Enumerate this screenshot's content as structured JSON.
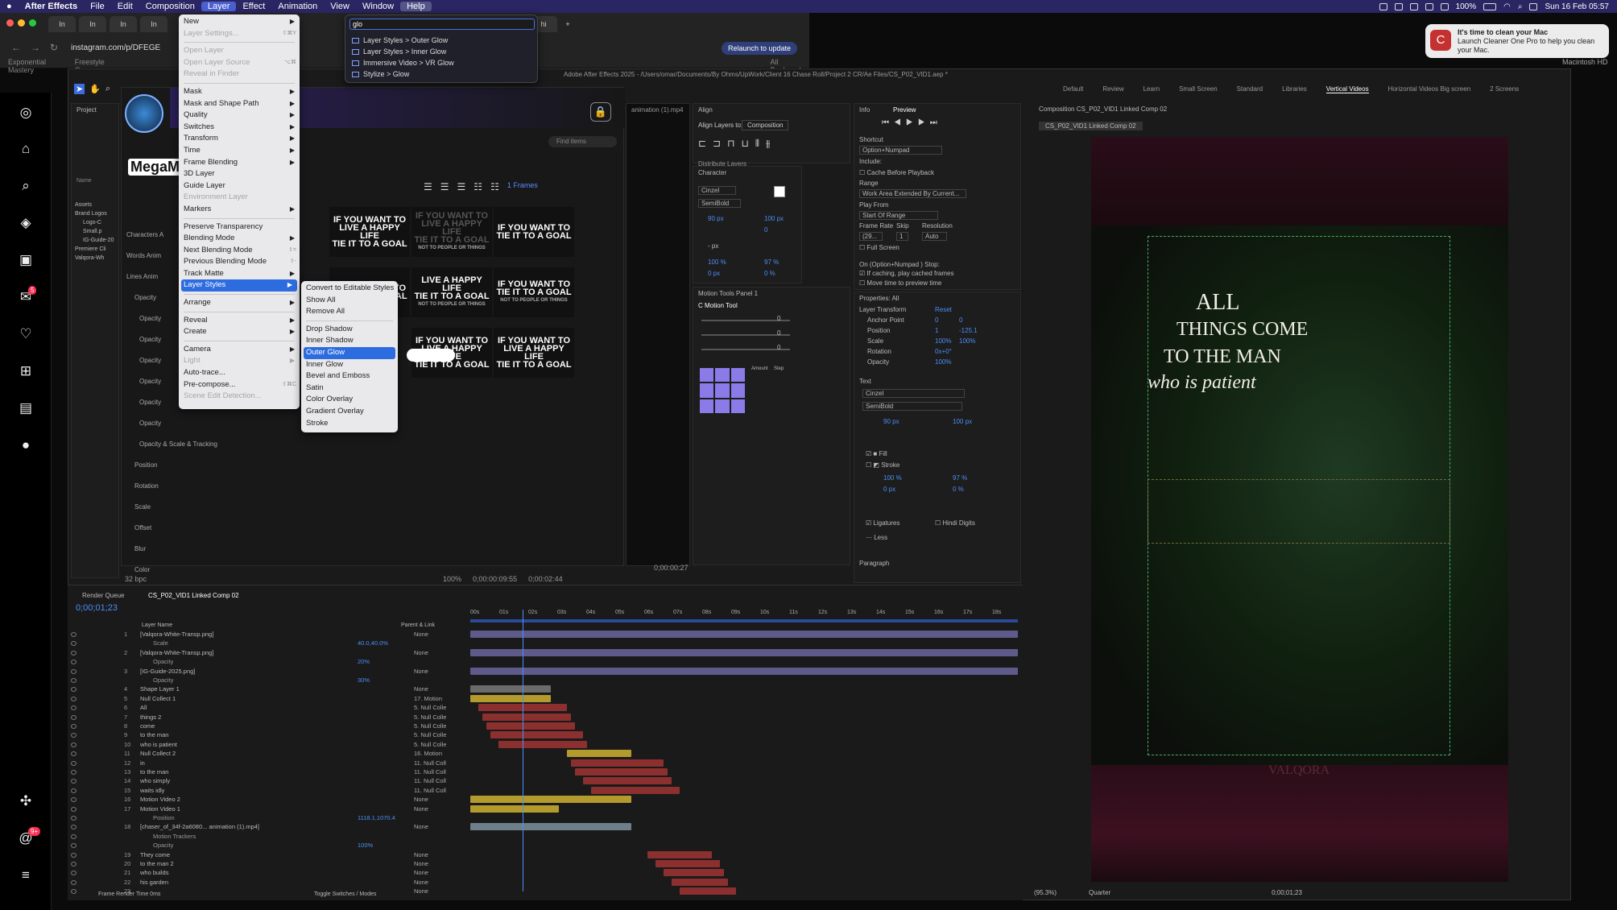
{
  "menubar": {
    "app": "After Effects",
    "items": [
      "File",
      "Edit",
      "Composition",
      "Layer",
      "Effect",
      "Animation",
      "View",
      "Window",
      "Help"
    ],
    "battery": "100%",
    "clock": "Sun 16 Feb 05:57"
  },
  "browser": {
    "url": "instagram.com/p/DFEGE",
    "relaunch": "Relaunch to update",
    "bookmark1": "Exponential Mastery",
    "bookmark2": "Freestyle On...",
    "bookmark3": "All Bookmarks",
    "tabs": [
      "In",
      "In",
      "In",
      "In",
      "In",
      "b",
      "11",
      "C",
      "hi"
    ]
  },
  "ig_sidebar": {
    "notif_badge": "5",
    "msg_badge": "9+"
  },
  "ae": {
    "title": "Adobe After Effects 2025 - /Users/omar/Documents/By Ohms/UpWork/Client 16 Chase Roll/Project 2 CR/Ae Files/CS_P02_VID1.aep *",
    "workspaces": [
      "Default",
      "Review",
      "Learn",
      "Small Screen",
      "Standard",
      "Libraries",
      "Vertical Videos",
      "Horizontal Videos Big screen",
      "2 Screens"
    ],
    "active_ws": "Vertical Videos"
  },
  "layer_menu": {
    "items": [
      {
        "l": "New",
        "arrow": true
      },
      {
        "l": "Layer Settings...",
        "dis": true,
        "sc": "⇧⌘Y"
      },
      {
        "sep": true
      },
      {
        "l": "Open Layer",
        "dis": true
      },
      {
        "l": "Open Layer Source",
        "dis": true,
        "sc": "⌥⌘"
      },
      {
        "l": "Reveal in Finder",
        "dis": true
      },
      {
        "sep": true
      },
      {
        "l": "Mask",
        "arrow": true
      },
      {
        "l": "Mask and Shape Path",
        "arrow": true
      },
      {
        "l": "Quality",
        "arrow": true
      },
      {
        "l": "Switches",
        "arrow": true
      },
      {
        "l": "Transform",
        "arrow": true
      },
      {
        "l": "Time",
        "arrow": true
      },
      {
        "l": "Frame Blending",
        "arrow": true
      },
      {
        "l": "3D Layer"
      },
      {
        "l": "Guide Layer"
      },
      {
        "l": "Environment Layer",
        "dis": true
      },
      {
        "l": "Markers",
        "arrow": true
      },
      {
        "sep": true
      },
      {
        "l": "Preserve Transparency"
      },
      {
        "l": "Blending Mode",
        "arrow": true
      },
      {
        "l": "Next Blending Mode",
        "sc": "⇧="
      },
      {
        "l": "Previous Blending Mode",
        "sc": "⇧-"
      },
      {
        "l": "Track Matte",
        "arrow": true
      },
      {
        "l": "Layer Styles",
        "arrow": true,
        "sel": true
      },
      {
        "sep": true
      },
      {
        "l": "Arrange",
        "arrow": true
      },
      {
        "sep": true
      },
      {
        "l": "Reveal",
        "arrow": true
      },
      {
        "l": "Create",
        "arrow": true
      },
      {
        "sep": true
      },
      {
        "l": "Camera",
        "arrow": true
      },
      {
        "l": "Light",
        "dis": true,
        "arrow": true
      },
      {
        "l": "Auto-trace..."
      },
      {
        "l": "Pre-compose...",
        "sc": "⇧⌘C"
      },
      {
        "l": "Scene Edit Detection...",
        "dis": true
      }
    ]
  },
  "layer_styles_sub": {
    "items": [
      {
        "l": "Convert to Editable Styles"
      },
      {
        "l": "Show All"
      },
      {
        "l": "Remove All"
      },
      {
        "sep": true
      },
      {
        "l": "Drop Shadow"
      },
      {
        "l": "Inner Shadow"
      },
      {
        "l": "Outer Glow",
        "sel": true
      },
      {
        "l": "Inner Glow"
      },
      {
        "l": "Bevel and Emboss"
      },
      {
        "l": "Satin"
      },
      {
        "l": "Color Overlay"
      },
      {
        "l": "Gradient Overlay"
      },
      {
        "l": "Stroke"
      }
    ]
  },
  "search": {
    "query": "glo",
    "results": [
      "Layer Styles > Outer Glow",
      "Layer Styles > Inner Glow",
      "Immersive Video > VR Glow",
      "Stylize > Glow"
    ]
  },
  "notification": {
    "title": "It's time to clean your Mac",
    "body": "Launch Cleaner One Pro to help you clean your Mac.",
    "user": "Macintosh HD"
  },
  "project": {
    "title": "Project",
    "items": [
      "Assets",
      "Brand Logos",
      "Logo-C",
      "Small.p",
      "IG-Guide-20",
      "Premiere Cli",
      "Valqora-Wh"
    ],
    "col": "Name"
  },
  "motionbro": {
    "brand": "MegaM",
    "find": "Find items",
    "frames": "1 Frames",
    "cats": [
      "Characters A",
      "Words Anim",
      "Lines Anim",
      "Opacity",
      "Opacity",
      "Opacity",
      "Opacity",
      "Opacity",
      "Opacity",
      "Opacity",
      "Opacity & Scale & Tracking",
      "Position",
      "Rotation",
      "Scale",
      "Offset",
      "Blur",
      "Color"
    ],
    "badge": "24"
  },
  "cards": {
    "t1": "IF YOU WANT TO",
    "t2": "LIVE A HAPPY LIFE",
    "t3": "TIE IT TO A GOAL",
    "sub": "NOT TO PEOPLE OR THINGS"
  },
  "align": {
    "title": "Align",
    "label": "Align Layers to:",
    "target": "Composition",
    "dist": "Distribute Layers"
  },
  "character": {
    "title": "Character",
    "font": "Cinzel",
    "style": "SemiBold",
    "size": "90 px",
    "lead": "100 px",
    "track": "0",
    "vscale": "100 %",
    "hscale": "97 %",
    "base": "0 px",
    "tsume": "0 %",
    "unit": "- px"
  },
  "motiontools": {
    "title": "Motion Tools Panel 1",
    "tool": "C Motion Tool",
    "vals": [
      "0",
      "0",
      "0"
    ],
    "amount": "Amount",
    "step": "Step"
  },
  "preview": {
    "tabs": [
      "Info",
      "Preview"
    ],
    "shortcut": "Shortcut",
    "shortcut_val": "Option+Numpad",
    "include": "Include:",
    "cache": "Cache Before Playback",
    "range": "Range",
    "range_val": "Work Area Extended By Current...",
    "playfrom": "Play From",
    "playfrom_val": "Start Of Range",
    "framerate": "Frame Rate",
    "skip": "Skip",
    "resolution": "Resolution",
    "fr_val": "(29...",
    "skip_val": "1",
    "res_val": "Auto",
    "fullscreen": "Full Screen",
    "stop": "On (Option+Numpad ) Stop:",
    "caching": "If caching, play cached frames",
    "movetime": "Move time to preview time"
  },
  "properties": {
    "title": "Properties: All",
    "transform": "Layer Transform",
    "reset": "Reset",
    "rows": [
      {
        "k": "Anchor Point",
        "v1": "0",
        "v2": "0"
      },
      {
        "k": "Position",
        "v1": "1",
        "v2": "-125.1"
      },
      {
        "k": "Scale",
        "v1": "100%",
        "v2": "100%"
      },
      {
        "k": "Rotation",
        "v1": "0x+0°",
        "v2": ""
      },
      {
        "k": "Opacity",
        "v1": "100%",
        "v2": ""
      }
    ],
    "text": "Text",
    "font": "Cinzel",
    "style": "SemiBold",
    "size": "90 px",
    "lead": "100 px",
    "fill": "Fill",
    "stroke": "Stroke",
    "vs": "100 %",
    "hs": "97 %",
    "base": "0 px",
    "ts": "0 %",
    "ligatures": "Ligatures",
    "hindi": "Hindi Digits",
    "less": "Less",
    "paragraph": "Paragraph"
  },
  "comp": {
    "tab": "Composition CS_P02_VID1 Linked Comp 02",
    "crumb": "CS_P02_VID1 Linked Comp 02",
    "line1": "ALL",
    "line2": "THINGS COME",
    "line3": "TO THE MAN",
    "line4": "who is patient",
    "brand": "VALQORA",
    "zoom": "(95.3%)",
    "quality": "Quarter",
    "time": "0;00;01;23"
  },
  "viewer": {
    "zoom": "100%",
    "tc1": "0;00:00:09:55",
    "tc2": "0;00:00:27",
    "tc3": "0;00:02:44",
    "bpc": "32 bpc"
  },
  "timeline": {
    "tabs": [
      "Render Queue",
      "CS_P02_VID1 Linked Comp 02"
    ],
    "timecode": "0;00;01;23",
    "col_name": "Layer Name",
    "col_parent": "Parent & Link",
    "ticks": [
      "00s",
      "01s",
      "02s",
      "03s",
      "04s",
      "05s",
      "06s",
      "07s",
      "08s",
      "09s",
      "10s",
      "11s",
      "12s",
      "13s",
      "14s",
      "15s",
      "16s",
      "17s",
      "18s"
    ],
    "footer": "Frame Render Time  0ms",
    "toggle": "Toggle Switches / Modes",
    "rows": [
      {
        "i": "1",
        "n": "[Valqora-White-Transp.png]",
        "p": "None"
      },
      {
        "i": "",
        "n": "Scale",
        "p": "40.0,40.0%"
      },
      {
        "i": "2",
        "n": "[Valqora-White-Transp.png]",
        "p": "None"
      },
      {
        "i": "",
        "n": "Opacity",
        "p": "20%"
      },
      {
        "i": "3",
        "n": "[IG-Guide-2025.png]",
        "p": "None"
      },
      {
        "i": "",
        "n": "Opacity",
        "p": "30%"
      },
      {
        "i": "4",
        "n": "Shape Layer 1",
        "p": "None"
      },
      {
        "i": "5",
        "n": "Null Collect 1",
        "p": "17. Motion"
      },
      {
        "i": "6",
        "n": "All",
        "p": "5. Null Colle"
      },
      {
        "i": "7",
        "n": "things 2",
        "p": "5. Null Colle"
      },
      {
        "i": "8",
        "n": "come",
        "p": "5. Null Colle"
      },
      {
        "i": "9",
        "n": "to the man",
        "p": "5. Null Colle"
      },
      {
        "i": "10",
        "n": "who is patient",
        "p": "5. Null Colle"
      },
      {
        "i": "11",
        "n": "Null Collect 2",
        "p": "16. Motion"
      },
      {
        "i": "12",
        "n": "in",
        "p": "11. Null Coll"
      },
      {
        "i": "13",
        "n": "to the man",
        "p": "11. Null Coll"
      },
      {
        "i": "14",
        "n": "who simply",
        "p": "11. Null Coll"
      },
      {
        "i": "15",
        "n": "waits idly",
        "p": "11. Null Coll"
      },
      {
        "i": "16",
        "n": "Motion Video 2",
        "p": "None"
      },
      {
        "i": "17",
        "n": "Motion Video 1",
        "p": "None"
      },
      {
        "i": "",
        "n": "Position",
        "p": "1118.1,1070.4"
      },
      {
        "i": "18",
        "n": "[chaser_of_34f-2a6080... animation (1).mp4]",
        "p": "None"
      },
      {
        "i": "",
        "n": "Motion Trackers",
        "p": ""
      },
      {
        "i": "",
        "n": "Opacity",
        "p": "100%"
      },
      {
        "i": "19",
        "n": "They come",
        "p": "None"
      },
      {
        "i": "20",
        "n": "to the man 2",
        "p": "None"
      },
      {
        "i": "21",
        "n": "who builds",
        "p": "None"
      },
      {
        "i": "22",
        "n": "his garden",
        "p": "None"
      },
      {
        "i": "23",
        "n": "",
        "p": "None"
      }
    ]
  }
}
